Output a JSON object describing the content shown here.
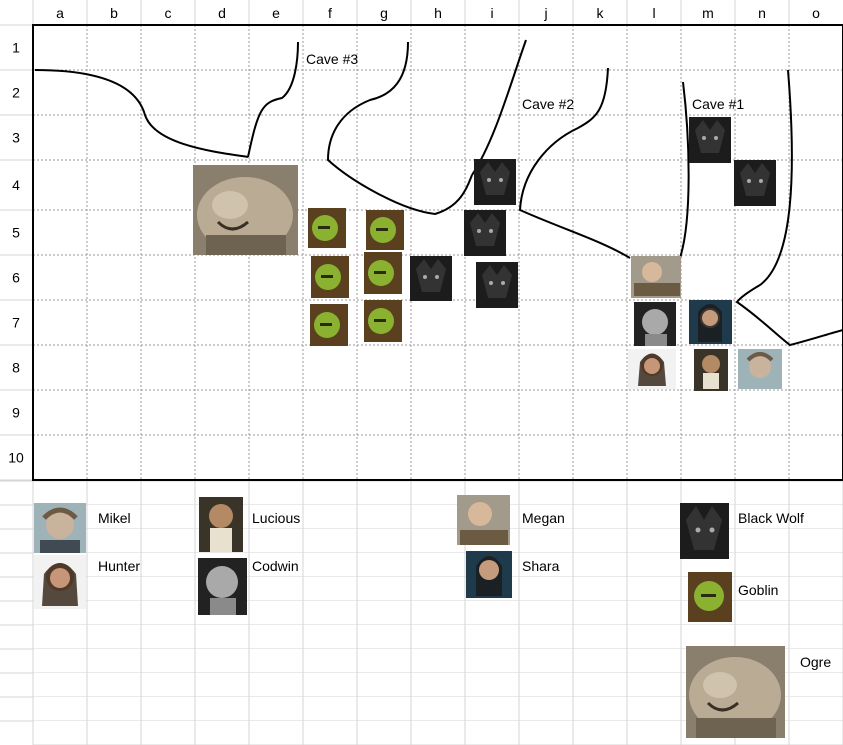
{
  "grid": {
    "column_headers": [
      "a",
      "b",
      "c",
      "d",
      "e",
      "f",
      "g",
      "h",
      "i",
      "j",
      "k",
      "l",
      "m",
      "n",
      "o"
    ],
    "row_headers": [
      "1",
      "2",
      "3",
      "4",
      "5",
      "6",
      "7",
      "8",
      "9",
      "10"
    ]
  },
  "map_labels": {
    "cave1": "Cave #1",
    "cave2": "Cave #2",
    "cave3": "Cave #3"
  },
  "legend": {
    "mikel": "Mikel",
    "hunter": "Hunter",
    "lucious": "Lucious",
    "codwin": "Codwin",
    "megan": "Megan",
    "shara": "Shara",
    "black_wolf": "Black Wolf",
    "goblin": "Goblin",
    "ogre": "Ogre"
  },
  "token_icons": {
    "ogre": "ogre-portrait",
    "goblin": "goblin-portrait",
    "black_wolf": "black-wolf-portrait",
    "mikel": "mikel-portrait",
    "hunter": "hunter-portrait",
    "lucious": "lucious-portrait",
    "codwin": "codwin-portrait",
    "megan": "megan-portrait",
    "shara": "shara-portrait"
  },
  "colors": {
    "sheet_grid": "#d4d4d4",
    "map_border": "#000000",
    "wolf": "#1c1c1c",
    "goblin": "#7a9a2a",
    "ogre_skin": "#b9ab94"
  }
}
